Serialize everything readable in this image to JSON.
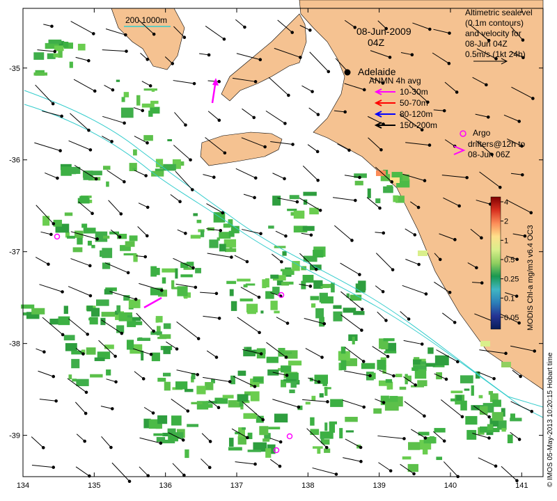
{
  "map": {
    "date": "08-Jun-2009",
    "time": "04Z",
    "city": "Adelaide",
    "scale_label": "200  1000m",
    "x_ticks": [
      "134",
      "135",
      "136",
      "137",
      "138",
      "139",
      "140",
      "141"
    ],
    "y_ticks": [
      "-35",
      "-36",
      "-37",
      "-38",
      "-39"
    ],
    "x_range": [
      134,
      141.3
    ],
    "y_range": [
      -39.45,
      -34.35
    ],
    "legend_top": [
      "Altimetric sealevel",
      "(0.1m contours)",
      "and velocity for",
      "08-Jun 04Z",
      "0.5m/s (1kt 24h)"
    ],
    "anmn": {
      "title": "ANMN 4h avg",
      "items": [
        {
          "label": "10-30m",
          "color": "#ff00ff"
        },
        {
          "label": "50-70m",
          "color": "#ff0000"
        },
        {
          "label": "80-120m",
          "color": "#0000ff"
        },
        {
          "label": "150-200m",
          "color": "#000000"
        }
      ]
    },
    "argo": {
      "lines": [
        "Argo",
        "drifters@12h to",
        "08-Jun 06Z"
      ],
      "color": "#ff00ff"
    },
    "colorbar": {
      "title": "MODIS Chl-a mg/m3 v6.4 OC3",
      "ticks": [
        "4",
        "2",
        "1",
        "0.5",
        "0.25",
        "0.1",
        "0.05"
      ],
      "colors": [
        "#7f0000",
        "#d7301f",
        "#fc8d59",
        "#fee08b",
        "#d9ef8b",
        "#91cf60",
        "#1a9850",
        "#41b6c4",
        "#2c7fb8",
        "#253494",
        "#081d58"
      ]
    },
    "credit": "© IMOS 05-May-2013 10:20:15 Hobart time",
    "land_color": "#f5c291",
    "contour_color": "#33cccc"
  }
}
